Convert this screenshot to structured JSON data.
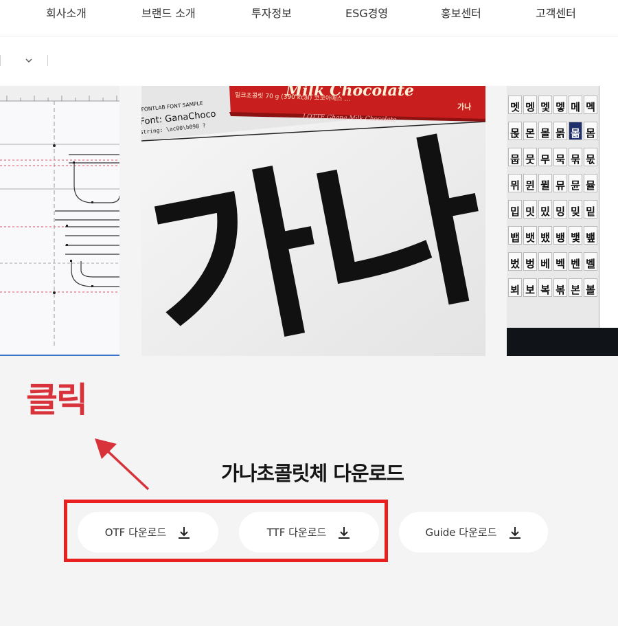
{
  "nav": {
    "items": [
      {
        "label": "회사소개"
      },
      {
        "label": "브랜드 소개"
      },
      {
        "label": "투자정보"
      },
      {
        "label": "ESG경영"
      },
      {
        "label": "홍보센터"
      },
      {
        "label": "고객센터"
      }
    ]
  },
  "gallery": {
    "center": {
      "package_text_main": "Milk Chocolate",
      "package_text_korean": "밀크초콜릿 70 g (390 kcal) 코코아매스 ...",
      "package_text_brand": "가나",
      "package_text_lotte": "LOTTE Ghana Milk Chocolate",
      "sample_label": "FONTLAB FONT SAMPLE",
      "sample_font": "Font: GanaChoco",
      "sample_string": "String: \\ac00\\b098  ?",
      "big_glyphs": "가나"
    },
    "right": {
      "glyph_rows": [
        [
          "멧",
          "멩",
          "멫",
          "멯",
          "메",
          "멕"
        ],
        [
          "몭",
          "몬",
          "몰",
          "몱",
          "몲",
          "몸"
        ],
        [
          "뭅",
          "뭇",
          "무",
          "묵",
          "묶",
          "묷"
        ],
        [
          "뮈",
          "뮌",
          "뮐",
          "뮤",
          "뮨",
          "뮬"
        ],
        [
          "밉",
          "밋",
          "밌",
          "밍",
          "밎",
          "밑"
        ],
        [
          "뱁",
          "뱃",
          "뱄",
          "뱅",
          "뱇",
          "뱊"
        ],
        [
          "벘",
          "벙",
          "베",
          "벡",
          "벤",
          "벨"
        ],
        [
          "뵈",
          "보",
          "복",
          "볶",
          "본",
          "볼"
        ]
      ]
    }
  },
  "annotation": {
    "click_label": "클릭"
  },
  "download": {
    "title": "가나초콜릿체 다운로드",
    "buttons": [
      {
        "label": "OTF 다운로드"
      },
      {
        "label": "TTF 다운로드"
      },
      {
        "label": "Guide 다운로드"
      }
    ]
  },
  "colors": {
    "annotation_red": "#ea1f1f",
    "click_label": "#d8323a",
    "chocolate_red": "#c81e1e",
    "page_bg": "#f4f4f4"
  },
  "icons": [
    "chevron-down-icon",
    "download-icon"
  ]
}
